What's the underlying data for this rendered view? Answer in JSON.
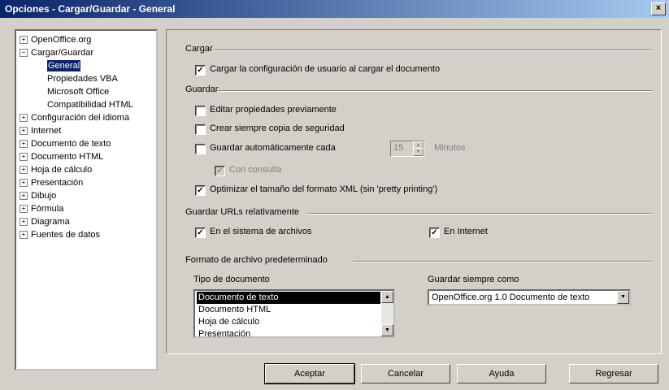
{
  "window": {
    "title": "Opciones - Cargar/Guardar - General",
    "close_glyph": "×"
  },
  "tree": {
    "items": [
      {
        "label": "OpenOffice.org",
        "expander": "+"
      },
      {
        "label": "Cargar/Guardar",
        "expander": "−"
      },
      {
        "label": "General",
        "selected": true
      },
      {
        "label": "Propiedades VBA"
      },
      {
        "label": "Microsoft Office"
      },
      {
        "label": "Compatibilidad HTML"
      },
      {
        "label": "Configuración del idioma",
        "expander": "+"
      },
      {
        "label": "Internet",
        "expander": "+"
      },
      {
        "label": "Documento de texto",
        "expander": "+"
      },
      {
        "label": "Documento HTML",
        "expander": "+"
      },
      {
        "label": "Hoja de cálculo",
        "expander": "+"
      },
      {
        "label": "Presentación",
        "expander": "+"
      },
      {
        "label": "Dibujo",
        "expander": "+"
      },
      {
        "label": "Fórmula",
        "expander": "+"
      },
      {
        "label": "Diagrama",
        "expander": "+"
      },
      {
        "label": "Fuentes de datos",
        "expander": "+"
      }
    ]
  },
  "cargar": {
    "title": "Cargar",
    "load_user_settings": {
      "label": "Cargar la configuración de usuario al cargar el documento",
      "checked": true
    }
  },
  "guardar": {
    "title": "Guardar",
    "edit_properties": {
      "label": "Editar propiedades previamente",
      "checked": false
    },
    "always_backup": {
      "label": "Crear siempre copia de seguridad",
      "checked": false
    },
    "autosave": {
      "label": "Guardar automáticamente cada",
      "checked": false,
      "minutes": "15",
      "unit": "Minutos"
    },
    "prompt": {
      "label": "Con consulta",
      "checked": true,
      "disabled": true
    },
    "optimize_xml": {
      "label": "Optimizar el tamaño del formato XML (sin 'pretty printing')",
      "checked": true
    }
  },
  "relative_urls": {
    "title": "Guardar URLs relativamente",
    "filesystem": {
      "label": "En el sistema de archivos",
      "checked": true
    },
    "internet": {
      "label": "En Internet",
      "checked": true
    }
  },
  "default_format": {
    "title": "Formato de archivo predeterminado",
    "doc_type_label": "Tipo de documento",
    "doc_types": [
      "Documento de texto",
      "Documento HTML",
      "Hoja de cálculo",
      "Presentación"
    ],
    "save_as_label": "Guardar siempre como",
    "save_as_value": "OpenOffice.org 1.0 Documento de texto"
  },
  "buttons": {
    "ok": "Aceptar",
    "cancel": "Cancelar",
    "help": "Ayuda",
    "back": "Regresar"
  },
  "glyphs": {
    "check": "✓",
    "arrow_up": "▲",
    "arrow_down": "▼"
  }
}
